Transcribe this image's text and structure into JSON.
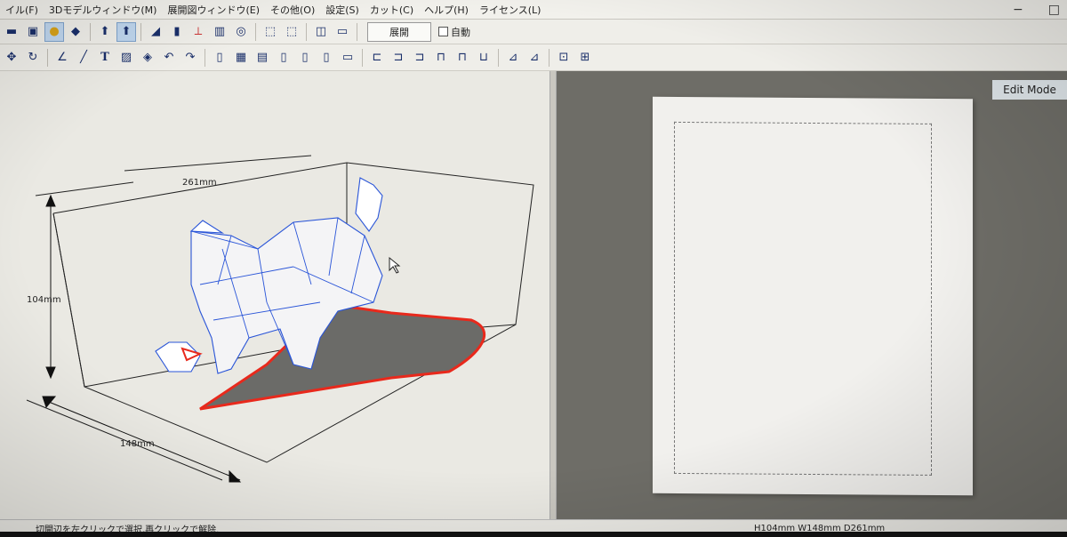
{
  "menubar": {
    "items": [
      "イル(F)",
      "3Dモデルウィンドウ(M)",
      "展開図ウィンドウ(E)",
      "その他(O)",
      "設定(S)",
      "カット(C)",
      "ヘルプ(H)",
      "ライセンス(L)"
    ],
    "minimize": "−",
    "maximize": "□"
  },
  "toolbar": {
    "expand_label": "展開",
    "auto_label": "自動",
    "auto_checked": false
  },
  "model_view": {
    "dim_width": "261mm",
    "dim_height": "104mm",
    "dim_depth": "148mm"
  },
  "unfold_view": {
    "mode_label": "Edit Mode"
  },
  "status": {
    "hint": "切開辺を左クリックで選択,再クリックで解除.",
    "dimensions": "H104mm W148mm D261mm"
  },
  "colors": {
    "cut_outline": "#e8291c",
    "mesh_edge": "#2a55d8",
    "shadow": "#6b6b68"
  }
}
